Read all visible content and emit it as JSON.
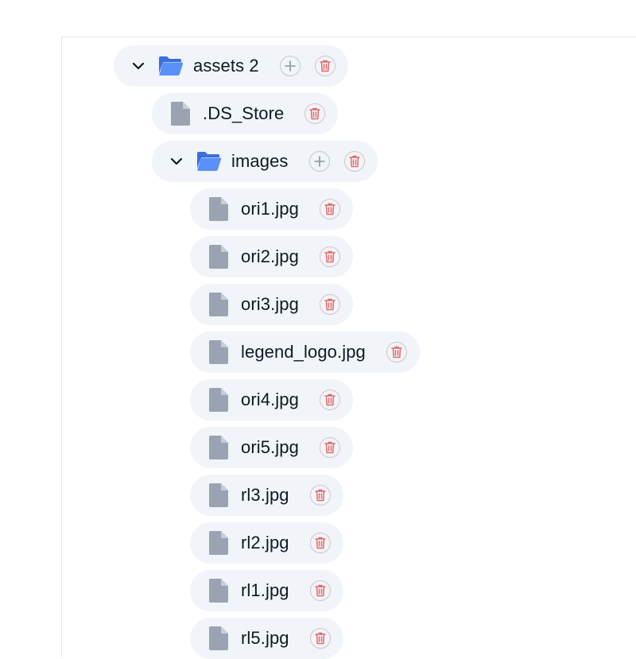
{
  "tree": {
    "root": {
      "name": "assets 2",
      "children_files": [
        ".DS_Store"
      ],
      "folder": {
        "name": "images",
        "files": [
          "ori1.jpg",
          "ori2.jpg",
          "ori3.jpg",
          "legend_logo.jpg",
          "ori4.jpg",
          "ori5.jpg",
          "rl3.jpg",
          "rl2.jpg",
          "rl1.jpg",
          "rl5.jpg"
        ]
      }
    }
  },
  "icons": {
    "chevron": "chevron-down-icon",
    "folder": "folder-open-icon",
    "file": "file-icon",
    "add": "plus-icon",
    "delete": "trash-icon"
  },
  "colors": {
    "row_bg": "#f1f4f8",
    "folder_blue": "#4f86f7",
    "file_gray": "#9aa3b2",
    "delete_red": "#e06b6b",
    "add_gray": "#8b93a1"
  }
}
